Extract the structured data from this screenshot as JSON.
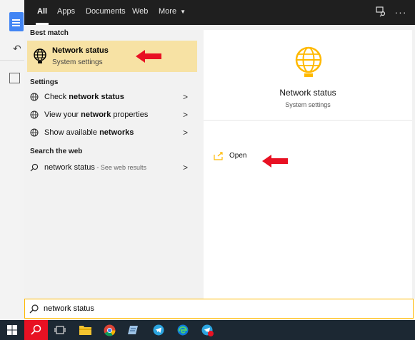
{
  "topbar": {
    "tabs": [
      "All",
      "Apps",
      "Documents",
      "Web",
      "More"
    ],
    "more_arrow": "▼",
    "feedback_icon": "feedback-icon",
    "more_options_label": "···"
  },
  "left": {
    "best_match_header": "Best match",
    "best_match": {
      "title": "Network status",
      "subtitle": "System settings",
      "icon": "globe-icon"
    },
    "settings_header": "Settings",
    "settings_items": [
      {
        "pre": "Check ",
        "bold": "network status",
        "post": ""
      },
      {
        "pre": "View your ",
        "bold": "network",
        "post": " properties"
      },
      {
        "pre": "Show available ",
        "bold": "networks",
        "post": ""
      }
    ],
    "web_header": "Search the web",
    "web_item": {
      "text": "network status",
      "sub": " - See web results"
    }
  },
  "right": {
    "title": "Network status",
    "subtitle": "System settings",
    "open_label": "Open"
  },
  "search": {
    "value": "network status"
  },
  "colors": {
    "accent": "#ffb900",
    "highlight": "#f7e2a4",
    "annotation": "#e81123"
  }
}
